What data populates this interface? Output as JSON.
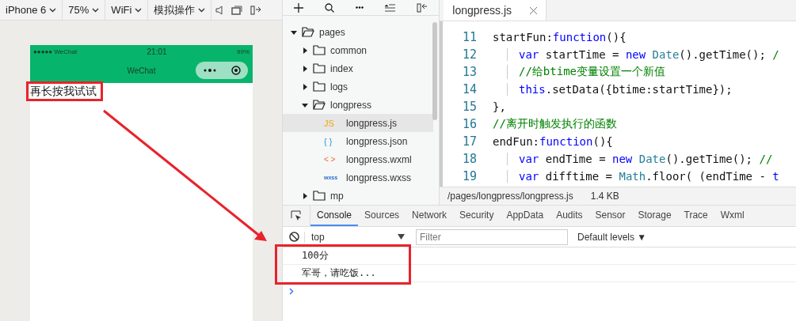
{
  "simulator_toolbar": {
    "dropdowns": [
      "iPhone 6",
      "75%",
      "WiFi",
      "模拟操作"
    ]
  },
  "phone": {
    "status_bar": {
      "carrier": "●●●●● WeChat",
      "time": "21:01",
      "battery": "99%"
    },
    "nav_title": "WeChat",
    "content_text": "再长按我试试"
  },
  "file_tree": [
    {
      "name": "pages",
      "kind": "folder",
      "expanded": true,
      "children": [
        {
          "name": "common",
          "kind": "folder",
          "expanded": false
        },
        {
          "name": "index",
          "kind": "folder",
          "expanded": false
        },
        {
          "name": "logs",
          "kind": "folder",
          "expanded": false
        },
        {
          "name": "longpress",
          "kind": "folder",
          "expanded": true,
          "children": [
            {
              "name": "longpress.js",
              "kind": "js",
              "icon_text": "JS",
              "selected": true
            },
            {
              "name": "longpress.json",
              "kind": "json",
              "icon_text": "{ }",
              "selected": false
            },
            {
              "name": "longpress.wxml",
              "kind": "wxml",
              "icon_text": "< >",
              "selected": false
            },
            {
              "name": "longpress.wxss",
              "kind": "wxss",
              "icon_text": "wxss",
              "selected": false
            }
          ]
        },
        {
          "name": "mp",
          "kind": "folder",
          "expanded": false
        }
      ]
    }
  ],
  "editor": {
    "tab": "longpress.js",
    "lines": [
      {
        "number": "11",
        "indented": false,
        "tokens": [
          {
            "kind": "plain",
            "text": "startFun:"
          },
          {
            "kind": "keyword",
            "text": "function"
          },
          {
            "kind": "plain",
            "text": "(){"
          }
        ]
      },
      {
        "number": "12",
        "indented": true,
        "tokens": [
          {
            "kind": "keyword",
            "text": "var"
          },
          {
            "kind": "plain",
            "text": " startTime = "
          },
          {
            "kind": "keyword",
            "text": "new"
          },
          {
            "kind": "type",
            "text": " Date"
          },
          {
            "kind": "plain",
            "text": "().getTime(); "
          },
          {
            "kind": "comment",
            "text": "/"
          }
        ]
      },
      {
        "number": "13",
        "indented": true,
        "tokens": [
          {
            "kind": "comment",
            "text": "//给btime变量设置一个新值"
          }
        ]
      },
      {
        "number": "14",
        "indented": true,
        "tokens": [
          {
            "kind": "keyword",
            "text": "this"
          },
          {
            "kind": "plain",
            "text": ".setData({btime:startTime});"
          }
        ]
      },
      {
        "number": "15",
        "indented": false,
        "tokens": [
          {
            "kind": "plain",
            "text": "},"
          }
        ]
      },
      {
        "number": "16",
        "indented": false,
        "tokens": [
          {
            "kind": "comment",
            "text": "//离开时触发执行的函数"
          }
        ]
      },
      {
        "number": "17",
        "indented": false,
        "tokens": [
          {
            "kind": "plain",
            "text": "endFun:"
          },
          {
            "kind": "keyword",
            "text": "function"
          },
          {
            "kind": "plain",
            "text": "(){"
          }
        ]
      },
      {
        "number": "18",
        "indented": true,
        "tokens": [
          {
            "kind": "keyword",
            "text": "var"
          },
          {
            "kind": "plain",
            "text": " endTime = "
          },
          {
            "kind": "keyword",
            "text": "new"
          },
          {
            "kind": "type",
            "text": " Date"
          },
          {
            "kind": "plain",
            "text": "().getTime(); "
          },
          {
            "kind": "comment",
            "text": "//"
          }
        ]
      },
      {
        "number": "19",
        "indented": true,
        "tokens": [
          {
            "kind": "keyword",
            "text": "var"
          },
          {
            "kind": "plain",
            "text": " difftime = "
          },
          {
            "kind": "type",
            "text": "Math"
          },
          {
            "kind": "plain",
            "text": ".floor( (endTime - "
          },
          {
            "kind": "keyword",
            "text": "t"
          }
        ]
      }
    ],
    "status_path": "/pages/longpress/longpress.js",
    "status_size": "1.4 KB"
  },
  "console": {
    "tabs": [
      {
        "label": "Console",
        "selected": true
      },
      {
        "label": "Sources",
        "selected": false
      },
      {
        "label": "Network",
        "selected": false
      },
      {
        "label": "Security",
        "selected": false
      },
      {
        "label": "AppData",
        "selected": false
      },
      {
        "label": "Audits",
        "selected": false
      },
      {
        "label": "Sensor",
        "selected": false
      },
      {
        "label": "Storage",
        "selected": false
      },
      {
        "label": "Trace",
        "selected": false
      },
      {
        "label": "Wxml",
        "selected": false
      }
    ],
    "context": "top",
    "filter_placeholder": "Filter",
    "levels": "Default levels ▼",
    "logs": [
      "100分",
      "军哥，请吃饭..."
    ]
  }
}
